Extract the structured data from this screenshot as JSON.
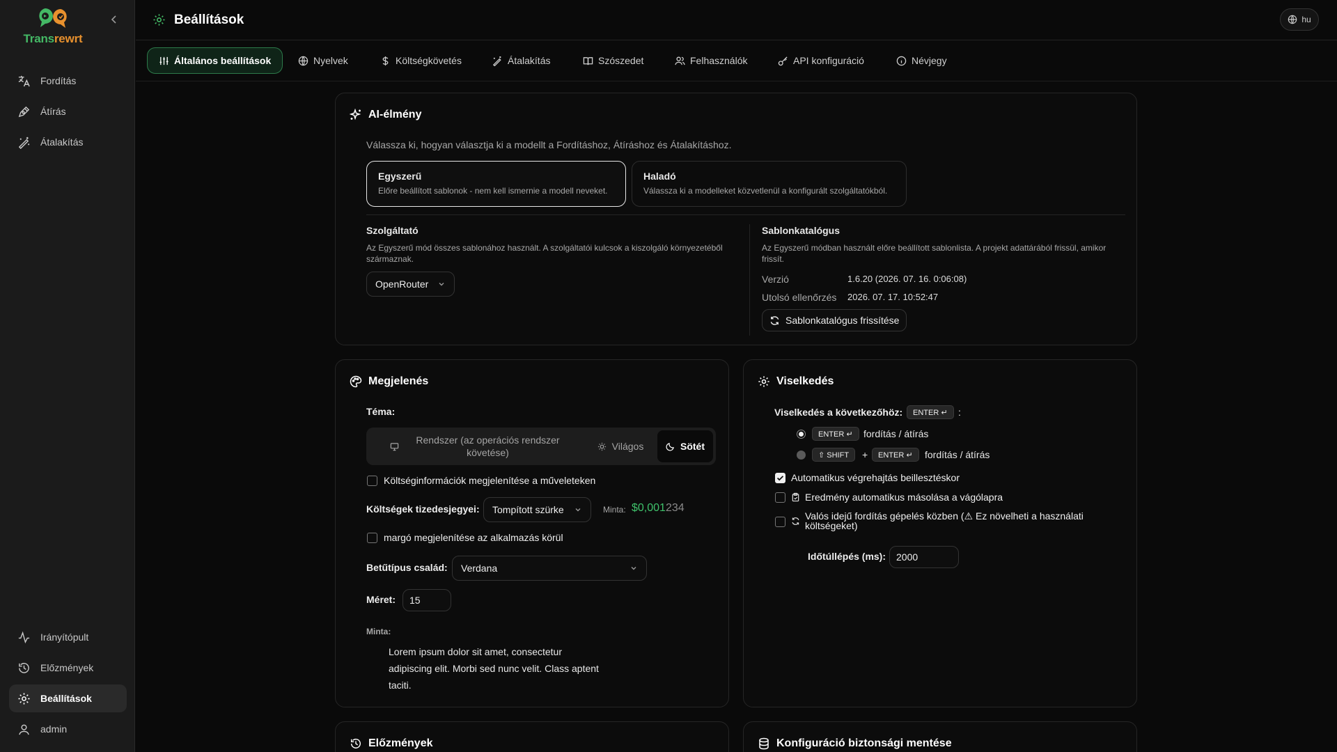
{
  "app": {
    "name_part1": "Trans",
    "name_part2": "rewrt"
  },
  "sidebar": {
    "top_items": [
      {
        "label": "Fordítás",
        "icon": "translate-icon"
      },
      {
        "label": "Átírás",
        "icon": "rewrite-icon"
      },
      {
        "label": "Átalakítás",
        "icon": "magic-wand-icon"
      }
    ],
    "bottom_items": [
      {
        "label": "Irányítópult",
        "icon": "activity-icon"
      },
      {
        "label": "Előzmények",
        "icon": "history-icon"
      },
      {
        "label": "Beállítások",
        "icon": "gear-icon",
        "active": true
      },
      {
        "label": "admin",
        "icon": "user-icon"
      }
    ]
  },
  "header": {
    "title": "Beállítások",
    "language": "hu"
  },
  "tabs": [
    {
      "label": "Általános beállítások",
      "active": true
    },
    {
      "label": "Nyelvek"
    },
    {
      "label": "Költségkövetés"
    },
    {
      "label": "Átalakítás"
    },
    {
      "label": "Szószedet"
    },
    {
      "label": "Felhasználók"
    },
    {
      "label": "API konfiguráció"
    },
    {
      "label": "Névjegy"
    }
  ],
  "ai": {
    "title": "AI-élmény",
    "description": "Válassza ki, hogyan választja ki a modellt a Fordításhoz, Átíráshoz és Átalakításhoz.",
    "modes": [
      {
        "title": "Egyszerű",
        "desc": "Előre beállított sablonok - nem kell ismernie a modell neveket.",
        "selected": true
      },
      {
        "title": "Haladó",
        "desc": "Válassza ki a modelleket közvetlenül a konfigurált szolgáltatókból."
      }
    ],
    "provider": {
      "label": "Szolgáltató",
      "desc": "Az Egyszerű mód összes sablonához használt. A szolgáltatói kulcsok a kiszolgáló környezetéből származnak.",
      "value": "OpenRouter"
    },
    "catalog": {
      "label": "Sablonkatalógus",
      "desc": "Az Egyszerű módban használt előre beállított sablonlista. A projekt adattárából frissül, amikor frissít.",
      "version_label": "Verzió",
      "version_value": "1.6.20 (2026. 07. 16. 0:06:08)",
      "last_check_label": "Utolsó ellenőrzés",
      "last_check_value": "2026. 07. 17. 10:52:47",
      "refresh_label": "Sablonkatalógus frissítése"
    }
  },
  "appearance": {
    "title": "Megjelenés",
    "theme_label": "Téma:",
    "theme_options": [
      {
        "label": "Rendszer (az operációs rendszer követése)"
      },
      {
        "label": "Világos"
      },
      {
        "label": "Sötét",
        "active": true
      }
    ],
    "cost_info_label": "Költséginformációk megjelenítése a műveleteken",
    "cost_info_checked": false,
    "decimals_label": "Költségek tizedesjegyei:",
    "decimals_value": "Tompított szürke",
    "sample_label": "Minta:",
    "sample_strong": "$0,001",
    "sample_dim": "234",
    "margin_label": "margó megjelenítése az alkalmazás körül",
    "margin_checked": false,
    "font_label": "Betűtípus család:",
    "font_value": "Verdana",
    "size_label": "Méret:",
    "size_value": "15",
    "preview_label": "Minta:",
    "preview_text": "Lorem ipsum dolor sit amet, consectetur adipiscing elit. Morbi sed nunc velit. Class aptent taciti."
  },
  "behavior": {
    "title": "Viselkedés",
    "enter_label": "Viselkedés a következőhöz:",
    "enter_key": "ENTER ↵",
    "colon": ":",
    "option1_key": "ENTER ↵",
    "option1_text": "fordítás / átírás",
    "option1_selected": true,
    "option2_key1": "⇧ SHIFT",
    "plus": "+",
    "option2_key2": "ENTER ↵",
    "option2_text": "fordítás / átírás",
    "auto_exec_label": "Automatikus végrehajtás beillesztéskor",
    "auto_exec_checked": true,
    "auto_copy_label": "Eredmény automatikus másolása a vágólapra",
    "auto_copy_checked": false,
    "realtime_label": "Valós idejű fordítás gépelés közben (⚠ Ez növelheti a használati költségeket)",
    "realtime_checked": false,
    "timeout_label": "Időtúllépés (ms):",
    "timeout_value": "2000"
  },
  "bottom_cards": {
    "history_title": "Előzmények",
    "backup_title": "Konfiguráció biztonsági mentése"
  },
  "colors": {
    "accent_green": "#44b865",
    "accent_orange": "#e8912e",
    "sample_green": "#3fc26b"
  }
}
